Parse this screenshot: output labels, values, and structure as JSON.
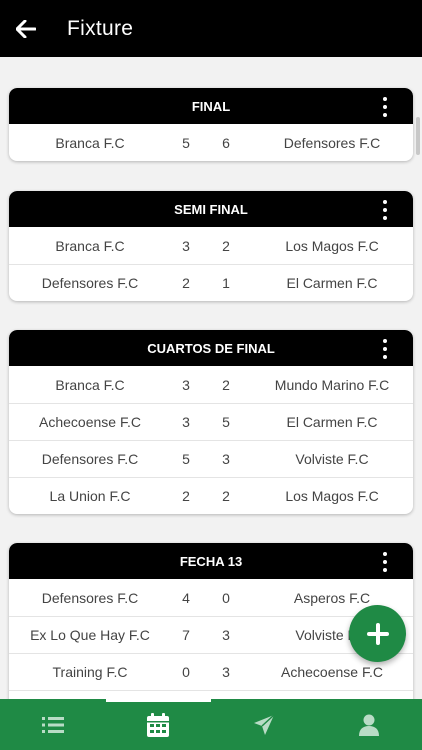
{
  "appbar": {
    "title": "Fixture",
    "back_icon": "arrow-left-icon"
  },
  "rounds": [
    {
      "title": "FINAL",
      "matches": [
        {
          "home": "Branca F.C",
          "home_score": "5",
          "away_score": "6",
          "away": "Defensores F.C"
        }
      ]
    },
    {
      "title": "SEMI FINAL",
      "matches": [
        {
          "home": "Branca F.C",
          "home_score": "3",
          "away_score": "2",
          "away": "Los Magos F.C"
        },
        {
          "home": "Defensores F.C",
          "home_score": "2",
          "away_score": "1",
          "away": "El Carmen F.C"
        }
      ]
    },
    {
      "title": "CUARTOS DE FINAL",
      "matches": [
        {
          "home": "Branca F.C",
          "home_score": "3",
          "away_score": "2",
          "away": "Mundo Marino F.C"
        },
        {
          "home": "Achecoense F.C",
          "home_score": "3",
          "away_score": "5",
          "away": "El Carmen F.C"
        },
        {
          "home": "Defensores F.C",
          "home_score": "5",
          "away_score": "3",
          "away": "Volviste F.C"
        },
        {
          "home": "La Union F.C",
          "home_score": "2",
          "away_score": "2",
          "away": "Los Magos F.C"
        }
      ]
    },
    {
      "title": "FECHA 13",
      "matches": [
        {
          "home": "Defensores F.C",
          "home_score": "4",
          "away_score": "0",
          "away": "Asperos F.C"
        },
        {
          "home": "Ex Lo Que Hay F.C",
          "home_score": "7",
          "away_score": "3",
          "away": "Volviste F.C"
        },
        {
          "home": "Training F.C",
          "home_score": "0",
          "away_score": "3",
          "away": "Achecoense F.C"
        }
      ]
    }
  ],
  "fab": {
    "icon": "plus-icon"
  },
  "bottom_nav": {
    "items": [
      {
        "icon": "list-icon",
        "active": false
      },
      {
        "icon": "calendar-icon",
        "active": true
      },
      {
        "icon": "send-icon",
        "active": false
      },
      {
        "icon": "user-icon",
        "active": false
      }
    ]
  },
  "colors": {
    "appbar": "#000000",
    "accent": "#1f8a45",
    "background": "#f2f2f2"
  }
}
